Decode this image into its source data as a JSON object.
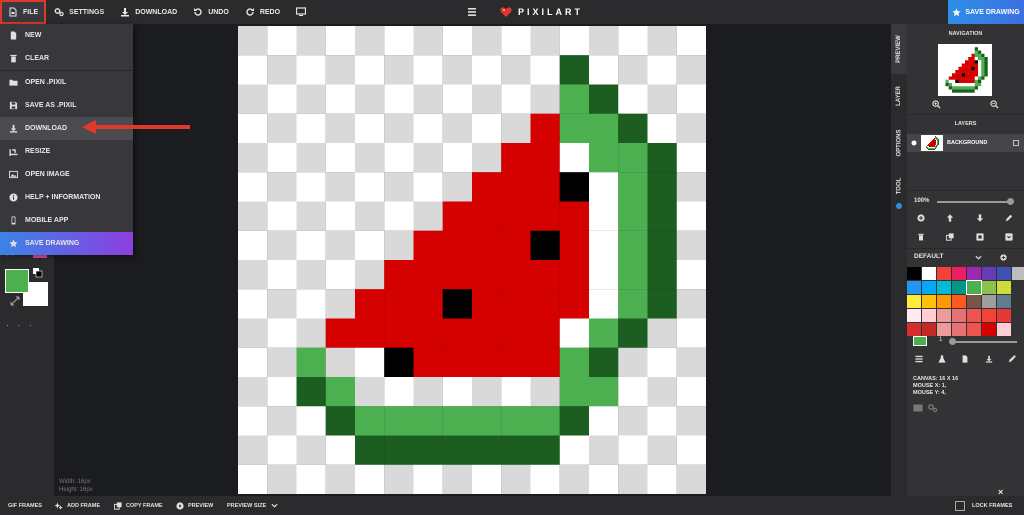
{
  "app": {
    "name": "PIXILART"
  },
  "toolbar": {
    "file": "FILE",
    "settings": "SETTINGS",
    "download": "DOWNLOAD",
    "undo": "UNDO",
    "redo": "REDO",
    "save_drawing": "SAVE DRAWING"
  },
  "file_menu": {
    "items": [
      {
        "label": "NEW",
        "icon": "new-file-icon"
      },
      {
        "label": "CLEAR",
        "icon": "trash-icon"
      },
      {
        "label": "OPEN .PIXIL",
        "icon": "folder-icon"
      },
      {
        "label": "SAVE AS .PIXIL",
        "icon": "save-icon"
      },
      {
        "label": "DOWNLOAD",
        "icon": "download-icon"
      },
      {
        "label": "RESIZE",
        "icon": "crop-icon"
      },
      {
        "label": "OPEN IMAGE",
        "icon": "image-icon"
      },
      {
        "label": "HELP + INFORMATION",
        "icon": "info-icon"
      },
      {
        "label": "MOBILE APP",
        "icon": "phone-icon"
      },
      {
        "label": "SAVE DRAWING",
        "icon": "star-icon"
      }
    ],
    "highlighted": "DOWNLOAD"
  },
  "canvas": {
    "grid_size": 16,
    "width_label": "Width: 16px",
    "height_label": "Height: 16px",
    "colors": {
      "r": "#d50000",
      "k": "#000000",
      "L": "#4caf50",
      "D": "#1b5e20",
      "W": "#ffffff"
    },
    "pixels": [
      "................",
      "...........D....",
      "...........LD...",
      "..........rLLD..",
      ".........rrWLLD.",
      "........rrrkWLD.",
      ".......rrrrrWLD.",
      "......rrrrkrWLD.",
      ".....rrrrrrrWLD.",
      "....rrrkrrrrWLD.",
      "...rrrrrrrrWLD..",
      "..L.WkrrrrrLD...",
      "..DL.......LL...",
      "...DLLLLLLLD....",
      "....DDDDDDD.....",
      "................"
    ]
  },
  "panel": {
    "tabs": [
      "PREVIEW",
      "LAYER",
      "OPTIONS",
      "TOOL"
    ],
    "navigation_title": "NAVIGATION",
    "layers_title": "LAYERS",
    "layer_name": "BACKGROUND",
    "zoom": "100%",
    "palette_name": "DEFAULT",
    "palette": [
      [
        "#000000",
        "#ffffff",
        "#f44336",
        "#e91e63",
        "#9c27b0",
        "#673ab7",
        "#3f51b5",
        "#bdbdbd"
      ],
      [
        "#2196f3",
        "#03a9f4",
        "#00bcd4",
        "#009688",
        "#4caf50",
        "#8bc34a",
        "#cddc39"
      ],
      [
        "#ffeb3b",
        "#ffc107",
        "#ff9800",
        "#ff5722",
        "#795548",
        "#9e9e9e",
        "#607d8b"
      ],
      [
        "#ffebee",
        "#ffcdd2",
        "#ef9a9a",
        "#e57373",
        "#ef5350",
        "#f44336",
        "#e53935"
      ],
      [
        "#d32f2f",
        "#c62828",
        "#ef9a9a",
        "#e57373",
        "#ef5350",
        "#d50000",
        "#ffcdd2"
      ]
    ],
    "brush_size": "1",
    "canvas_info": "CANVAS: 16 X 16",
    "mouse_x": "MOUSE X: 1,",
    "mouse_y": "MOUSE Y: 4,",
    "close": "×"
  },
  "colors": {
    "primary": "#4caf50",
    "secondary": "#ffffff",
    "accent": "#2f8fe8"
  },
  "bottom": {
    "gif_frames": "GIF FRAMES",
    "add_frame": "ADD FRAME",
    "copy_frame": "COPY FRAME",
    "preview": "PREVIEW",
    "preview_size": "PREVIEW SIZE",
    "lock_frames": "LOCK FRAMES"
  }
}
